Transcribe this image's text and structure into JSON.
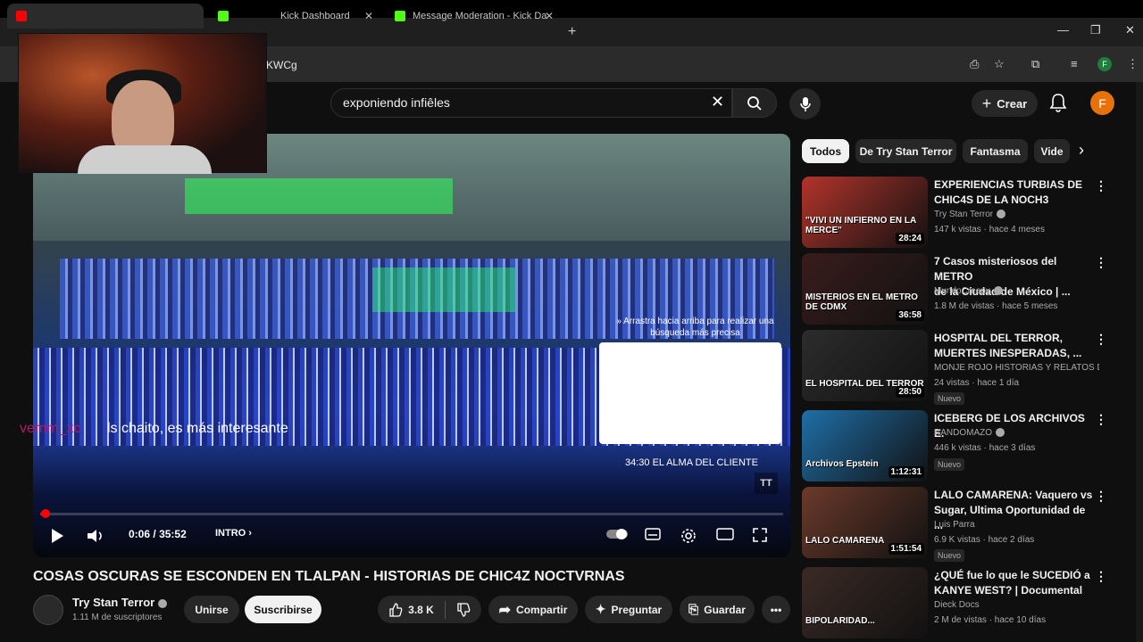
{
  "browser": {
    "tabs": [
      {
        "label": "",
        "active": true
      },
      {
        "label": "Kick Dashboard",
        "active": false
      },
      {
        "label": "Message Moderation - Kick Da",
        "active": false
      }
    ],
    "url_visible": "KWCg",
    "profile_initial": "F"
  },
  "header": {
    "search_query": "exponiendo infiêles",
    "create_label": "Crear",
    "avatar_initial": "F"
  },
  "player": {
    "drag_hint": "» Arrastra hacia arriba para realizar una búsqueda más precisa",
    "chapter_marker": "34:30   EL ALMA DEL CLIENTE",
    "tt_label": "TT",
    "time_current": "0:06",
    "time_separator": "/",
    "time_total": "35:52",
    "chapter_label": "INTRO",
    "progress": 0.003
  },
  "chat": {
    "user": "vemm_xc",
    "message": "ls chaito, es más interesante"
  },
  "video": {
    "title": "COSAS OSCURAS SE ESCONDEN EN TLALPAN - HISTORIAS DE CHIC4Z NOCTVRNAS",
    "channel": "Try Stan Terror",
    "subscribers": "1.11 M de suscriptores",
    "join_label": "Unirse",
    "subscribe_label": "Suscribirse",
    "likes": "3.8 K",
    "share_label": "Compartir",
    "ask_label": "Preguntar",
    "save_label": "Guardar"
  },
  "chips": [
    "Todos",
    "De Try Stan Terror",
    "Fantasma",
    "Vide"
  ],
  "recommendations": [
    {
      "title_line1": "EXPERIENCIAS TURBIAS DE",
      "title_line2": "CHIC4S DE LA NOCH3",
      "channel": "Try Stan Terror",
      "verified": true,
      "meta": "147 k vistas · hace 4 meses",
      "badge": "",
      "duration": "28:24",
      "thumb_text": "\"VIVI UN INFIERNO EN LA MERCE\"",
      "thumb_color": "#b3342b"
    },
    {
      "title_line1": "7 Casos misteriosos del METRO",
      "title_line2": "de la Ciudad de México | ...",
      "channel": "MundoCreepy",
      "verified": true,
      "meta": "1.8 M de vistas · hace 5 meses",
      "badge": "",
      "duration": "36:58",
      "thumb_text": "MISTERIOS EN EL METRO DE CDMX",
      "thumb_color": "#3a1c1c"
    },
    {
      "title_line1": "HOSPITAL DEL TERROR,",
      "title_line2": "MUERTES INESPERADAS, ...",
      "channel": "MONJE ROJO HISTORIAS Y RELATOS D...",
      "verified": false,
      "meta": "24 vistas · hace 1 día",
      "badge": "Nuevo",
      "duration": "28:50",
      "thumb_text": "EL HOSPITAL DEL TERROR",
      "thumb_color": "#2c2c2c"
    },
    {
      "title_line1": "ICEBERG DE LOS ARCHIVOS E.",
      "title_line2": "",
      "channel": "RANDOMAZO",
      "verified": true,
      "meta": "446 k vistas · hace 3 días",
      "badge": "Nuevo",
      "duration": "1:12:31",
      "thumb_text": "Archivos Epstein",
      "thumb_color": "#1f6fa8"
    },
    {
      "title_line1": "LALO CAMARENA: Vaquero vs",
      "title_line2": "Sugar, Ultima Oportunidad de ...",
      "channel": "Luis Parra",
      "verified": false,
      "meta": "6.9 K vistas · hace 2 días",
      "badge": "Nuevo",
      "duration": "1:51:54",
      "thumb_text": "LALO CAMARENA",
      "thumb_color": "#6b3a2a"
    },
    {
      "title_line1": "¿QUÉ fue lo que le SUCEDIÓ a",
      "title_line2": "KANYE WEST? | Documental",
      "channel": "Dieck Docs",
      "verified": false,
      "meta": "2 M de vistas · hace 10 días",
      "badge": "",
      "duration": "",
      "thumb_text": "BIPOLARIDAD...",
      "thumb_color": "#3b2a25"
    }
  ],
  "colors": {
    "accent": "#ff0000",
    "background": "#0f0f0f",
    "chat_user": "#b5176d"
  }
}
